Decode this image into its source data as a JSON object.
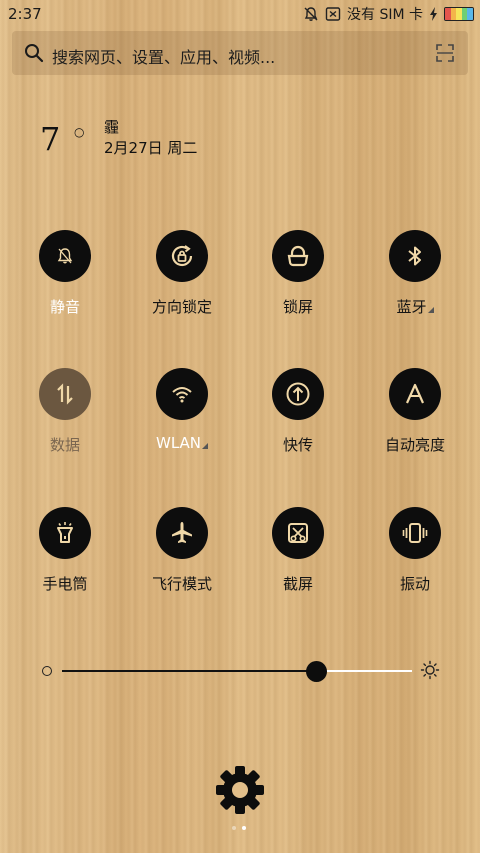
{
  "status_bar": {
    "time": "2:37",
    "sim_text": "没有 SIM 卡",
    "icons": [
      "bell-off-icon",
      "no-sim-icon",
      "charging-icon",
      "battery-icon"
    ]
  },
  "search": {
    "placeholder": "搜索网页、设置、应用、视频..."
  },
  "weather": {
    "temperature": "7",
    "degree_symbol": "○",
    "condition": "霾",
    "date": "2月27日 周二"
  },
  "toggles": [
    {
      "id": "mute",
      "label": "静音",
      "icon": "bell-off-icon",
      "state": "on"
    },
    {
      "id": "rotation-lock",
      "label": "方向锁定",
      "icon": "rotation-lock-icon",
      "state": "on"
    },
    {
      "id": "lock-screen",
      "label": "锁屏",
      "icon": "lock-icon",
      "state": "on"
    },
    {
      "id": "bluetooth",
      "label": "蓝牙",
      "icon": "bluetooth-icon",
      "state": "on"
    },
    {
      "id": "data",
      "label": "数据",
      "icon": "data-transfer-icon",
      "state": "disabled"
    },
    {
      "id": "wlan",
      "label": "WLAN",
      "icon": "wifi-icon",
      "state": "on"
    },
    {
      "id": "quick-send",
      "label": "快传",
      "icon": "upload-icon",
      "state": "on"
    },
    {
      "id": "auto-brightness",
      "label": "自动亮度",
      "icon": "auto-brightness-icon",
      "state": "on"
    },
    {
      "id": "flashlight",
      "label": "手电筒",
      "icon": "flashlight-icon",
      "state": "on"
    },
    {
      "id": "airplane",
      "label": "飞行模式",
      "icon": "airplane-icon",
      "state": "on"
    },
    {
      "id": "screenshot",
      "label": "截屏",
      "icon": "screenshot-icon",
      "state": "on"
    },
    {
      "id": "vibrate",
      "label": "振动",
      "icon": "vibrate-icon",
      "state": "on"
    }
  ],
  "brightness": {
    "level": 0.72
  },
  "page_indicator": {
    "count": 2,
    "active": 1
  },
  "colors": {
    "toggle_bg": "#0d0d0d",
    "toggle_icon": "#f0d8a8",
    "disabled_bg": "#6b5740"
  }
}
